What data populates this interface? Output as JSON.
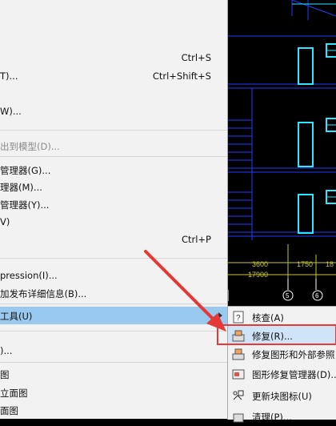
{
  "menu": {
    "items": [
      {
        "label": "",
        "shortcut": "Ctrl+S"
      },
      {
        "label": "T)...",
        "shortcut": "Ctrl+Shift+S"
      },
      {
        "label": "W)...",
        "shortcut": ""
      },
      {
        "label": "出到模型(D)...",
        "shortcut": ""
      },
      {
        "label": "管理器(G)...",
        "shortcut": ""
      },
      {
        "label": "理器(M)...",
        "shortcut": ""
      },
      {
        "label": "管理器(Y)...",
        "shortcut": ""
      },
      {
        "label": "V)",
        "shortcut": ""
      },
      {
        "label": "",
        "shortcut": "Ctrl+P"
      },
      {
        "label": "pression(I)...",
        "shortcut": ""
      },
      {
        "label": "加发布详细信息(B)...",
        "shortcut": ""
      },
      {
        "label": "工具(U)",
        "shortcut": ""
      },
      {
        "label": ")...",
        "shortcut": ""
      },
      {
        "label": "图",
        "shortcut": ""
      },
      {
        "label": "立面图",
        "shortcut": ""
      },
      {
        "label": "面图",
        "shortcut": ""
      }
    ]
  },
  "cad": {
    "dim_3600": "3600",
    "dim_1750": "1750",
    "dim_17900": "17900",
    "dim_18": "18",
    "axis_5": "5",
    "axis_6": "6"
  },
  "submenu": {
    "items": [
      {
        "label": "核查(A)",
        "icon": "audit-icon"
      },
      {
        "label": "修复(R)...",
        "icon": "recover-icon"
      },
      {
        "label": "修复图形和外部参照",
        "icon": "recover-xref-icon"
      },
      {
        "label": "图形修复管理器(D)...",
        "icon": "drawing-recovery-icon"
      },
      {
        "label": "更新块图标(U)",
        "icon": "update-block-icon"
      },
      {
        "label": "清理(P)...",
        "icon": "purge-icon"
      }
    ]
  },
  "colors": {
    "highlight": "#99c9ef",
    "cad_line": "#1f3bff",
    "cad_window": "#2ee6ff",
    "annotation": "#e53935"
  }
}
